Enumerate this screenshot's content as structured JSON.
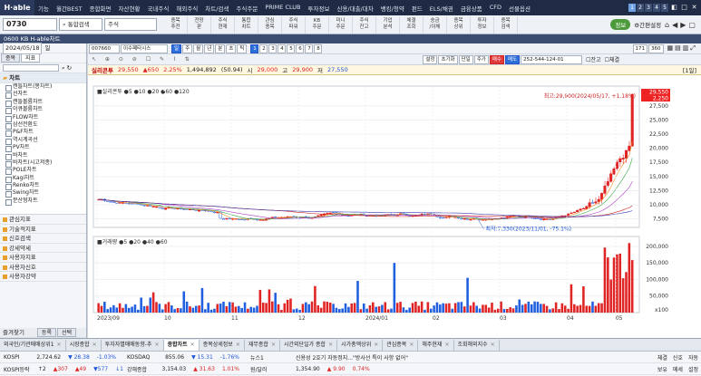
{
  "topbar": {
    "logo": "H·able",
    "menus": [
      "기능",
      "월간BEST",
      "종합화면",
      "자산현황",
      "국내주식",
      "해외주식",
      "차트/검색",
      "주식주문",
      "PRIME CLUB",
      "투자정보",
      "신용/대출/대차",
      "뱅킹/청약",
      "펀드",
      "ELS/채권",
      "금융상품",
      "CFD",
      "선물옵션"
    ],
    "pages": [
      "1",
      "2",
      "3",
      "4",
      "5"
    ],
    "winbtns": [
      "◧",
      "□",
      "✕"
    ]
  },
  "toolbar": {
    "code": "0730",
    "search_btn": "통합검색",
    "market": "주식",
    "icons": [
      "종목\n추천",
      "전망\n판",
      "주식\n현재",
      "통합\n차트",
      "관심\n종목",
      "주식\n파워",
      "KB\n주문",
      "미니\n주문",
      "주식\n잔고",
      "기업\n분석",
      "체결\n조회",
      "송금\n/이체",
      "종목\n상위",
      "투자\n정보",
      "종목\n검색"
    ],
    "green_btn": "정보",
    "settings": "간편설정"
  },
  "title": "0600 KB H-able차트",
  "left": {
    "date": "2024/05/18",
    "period": "일",
    "tabs": [
      "종목",
      "지표"
    ],
    "search_placeholder": "",
    "section": "차트",
    "tree": [
      "캔들차트(봉차트)",
      "선차트",
      "캔들볼륨차트",
      "이큐볼륨차트",
      "FLOW차트",
      "삼선전환도",
      "P&F차트",
      "역시계곡선",
      "PV차트",
      "바차트",
      "바차트(시고저종)",
      "POLE차트",
      "Kagi차트",
      "Renko차트",
      "Swing차트",
      "분산형차트"
    ],
    "sections": [
      "관심지표",
      "기술적지표",
      "신호검색",
      "강세약세",
      "사용자지표",
      "사용자신호",
      "사용자강약"
    ],
    "bottom": {
      "label": "즐겨찾기",
      "b1": "등록",
      "b2": "선택"
    }
  },
  "controls": {
    "code": "007660",
    "name": "이수페타시스",
    "btns1": [
      "일",
      "주",
      "월",
      "년",
      "분",
      "초",
      "틱"
    ],
    "nums": [
      "1",
      "2",
      "3",
      "4",
      "5",
      "6",
      "7",
      "8"
    ],
    "count": "171",
    "total": "360",
    "btns2": [
      "설정",
      "초기화",
      "단일",
      "주가",
      "매수",
      "매도"
    ],
    "account": "252-544-124-01",
    "cb1": "잔고",
    "cb2": "체결"
  },
  "info": {
    "label": "실리콘투",
    "price": "29,550",
    "change": "▲650",
    "rate": "2.25%",
    "volume": "1,494,892",
    "ratio": "(50.94)",
    "open_l": "시",
    "open": "29,000",
    "high_l": "고",
    "high": "29,900",
    "low_l": "저",
    "low": "27,550",
    "page": "[1일]"
  },
  "legend": {
    "name": "실리콘투",
    "mas": [
      "5",
      "10",
      "20",
      "60",
      "120"
    ],
    "vol_name": "거래량",
    "vmas": [
      "5",
      "20",
      "40",
      "60"
    ]
  },
  "annot": {
    "high": "최고:29,900(2024/05/17, +1.18%)",
    "low": "최저:7,330(2023/11/01, -75.1%)"
  },
  "chart_data": {
    "type": "candlestick",
    "price_ticks": [
      "29,550",
      "27,500",
      "25,000",
      "22,500",
      "20,000",
      "17,500",
      "15,000",
      "12,500",
      "10,000",
      "7,500"
    ],
    "vol_ticks": [
      "200,000",
      "150,000",
      "100,000",
      "50,000",
      "x100"
    ],
    "xticks": [
      "2023/09",
      "10",
      "11",
      "12",
      "2024/01",
      "02",
      "03",
      "04",
      "05"
    ],
    "ymin": 6000,
    "ymax": 31000,
    "last": 29550,
    "last_label": "29,550",
    "last_sub": "2,250",
    "high": 29900,
    "low": 7330
  },
  "bottomtabs": [
    {
      "label": "외국인/기관매매상위1"
    },
    {
      "label": "시장종합"
    },
    {
      "label": "투자자별매매동향-추"
    },
    {
      "label": "종합차트",
      "on": true
    },
    {
      "label": "종목상세정보"
    },
    {
      "label": "재무종합"
    },
    {
      "label": "시간외단일가 종합"
    },
    {
      "label": "시가총액상위"
    },
    {
      "label": "관심종목"
    },
    {
      "label": "해주현재"
    },
    {
      "label": "조회해외지수"
    }
  ],
  "ticker": {
    "r1": [
      {
        "n": "KOSPI",
        "v": "2,724.62",
        "c": "▼ 28.38",
        "r": "-1.03%"
      },
      {
        "n": "KOSDAQ",
        "v": "855.06",
        "c": "▼ 15.31",
        "r": "-1.76%"
      },
      {
        "n": "뉴스1",
        "v": "신용성 2호기 자동정지...\"방사선 특이 사항 없어\""
      }
    ],
    "r2": [
      {
        "n": "KOSPI등락",
        "v": "↑2",
        "c": "▲307",
        "r": "▲49",
        "x": "▼577",
        "y": "↓1"
      },
      {
        "n": "강해종합",
        "v": "3,154.03",
        "c": "▲ 31.63",
        "r": "1.01%"
      },
      {
        "n": "원/달러",
        "v": "1,354.90",
        "c": "▲ 9.90",
        "r": "0.74%"
      }
    ],
    "right1": [
      "체결",
      "신호",
      "자동"
    ],
    "right2": [
      "보유",
      "메세",
      "설정"
    ]
  }
}
